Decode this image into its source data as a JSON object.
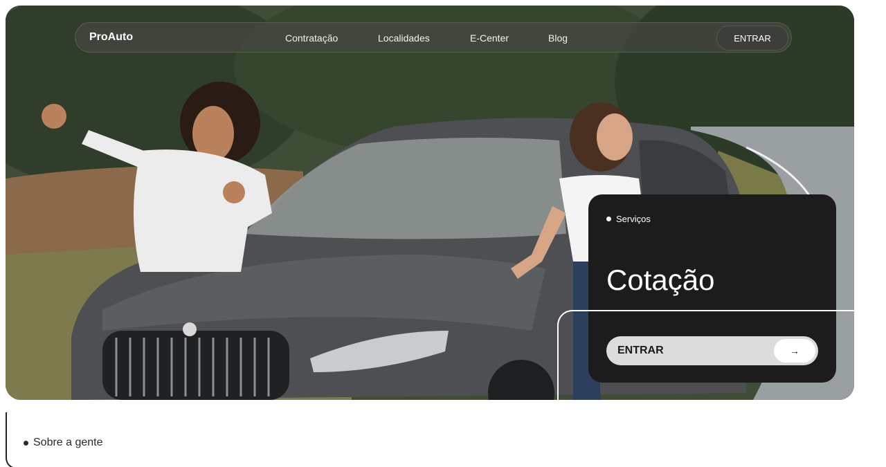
{
  "nav": {
    "brand": "ProAuto",
    "links": [
      "Contratação",
      "Localidades",
      "E-Center",
      "Blog"
    ],
    "enter_label": "ENTRAR"
  },
  "card": {
    "tag": "Serviços",
    "title": "Cotação",
    "cta_label": "ENTRAR",
    "cta_icon": "arrow-right-icon"
  },
  "about": {
    "tag": "Sobre a gente"
  },
  "colors": {
    "card_bg": "#1c1c1c",
    "cta_bg": "#dcdcdc",
    "nav_bg": "#464844"
  }
}
